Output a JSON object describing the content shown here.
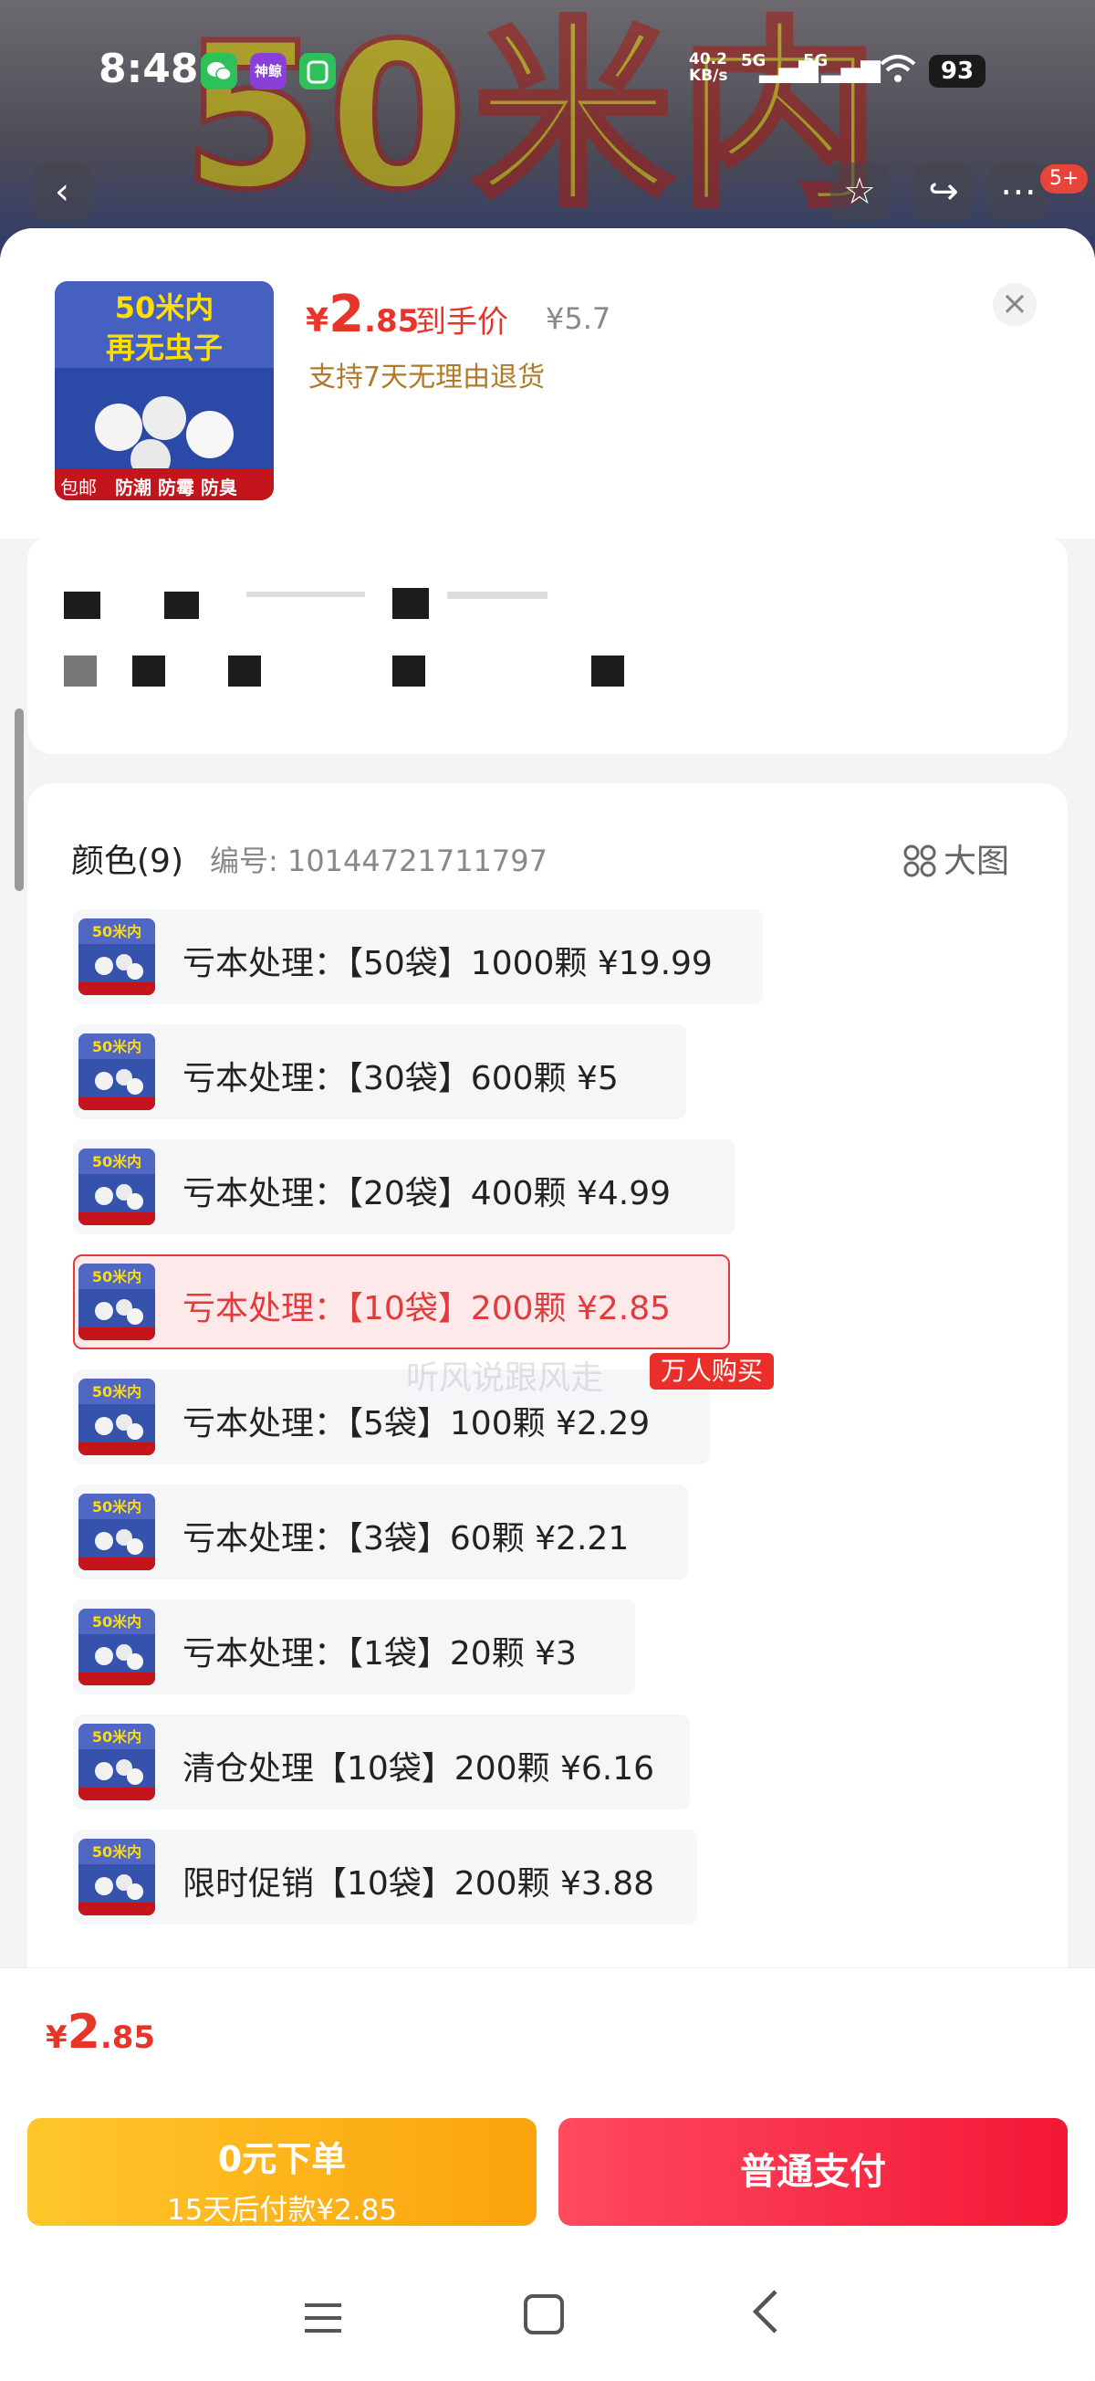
{
  "status_bar": {
    "time": "8:48",
    "network_speed_line1": "40.2",
    "network_speed_line2": "KB/s",
    "network_type_1": "5G",
    "network_type_2": "5G",
    "battery": "93",
    "apps": [
      {
        "name": "wechat-icon",
        "color": "#2ec15b"
      },
      {
        "name": "shenjing-icon",
        "color": "#8a3fd8",
        "text": "神鲸"
      },
      {
        "name": "mijia-icon",
        "color": "#2ec15b"
      }
    ]
  },
  "background_page": {
    "banner_text": "50米内",
    "message_badge": "5+"
  },
  "product_header": {
    "price_currency": "¥",
    "price_integer": "2",
    "price_decimal": ".85",
    "price_label": "到手价",
    "original_price": "¥5.7",
    "return_policy": "支持7天无理由退货",
    "image_text_line1": "50米内",
    "image_text_line2": "再无虫子",
    "image_tag_left": "包邮",
    "image_tags": "防潮 防霉 防臭"
  },
  "variants_section": {
    "title": "颜色(9)",
    "code": "编号: 10144721711797",
    "big_picture_label": "大图",
    "hot_badge": "万人购买",
    "watermark": "听风说跟风走",
    "items": [
      {
        "label": "亏本处理：【50袋】1000颗  ¥19.99",
        "selected": false
      },
      {
        "label": "亏本处理：【30袋】600颗  ¥5",
        "selected": false
      },
      {
        "label": "亏本处理：【20袋】400颗  ¥4.99",
        "selected": false
      },
      {
        "label": "亏本处理：【10袋】200颗  ¥2.85",
        "selected": true
      },
      {
        "label": "亏本处理：【5袋】100颗  ¥2.29",
        "selected": false
      },
      {
        "label": "亏本处理：【3袋】60颗  ¥2.21",
        "selected": false
      },
      {
        "label": "亏本处理：【1袋】20颗  ¥3",
        "selected": false
      },
      {
        "label": "清仓处理【10袋】200颗  ¥6.16",
        "selected": false
      },
      {
        "label": "限时促销【10袋】200颗  ¥3.88",
        "selected": false
      }
    ]
  },
  "bottom": {
    "price_currency": "¥",
    "price_integer": "2",
    "price_decimal": ".85",
    "credit_button_line1": "0元下单",
    "credit_button_line2": "15天后付款¥2.85",
    "pay_button": "普通支付"
  },
  "colors": {
    "accent_red": "#e8352a",
    "selected_border": "#e23b3b",
    "credit_yellow": "#fba30c",
    "pay_red": "#f31736"
  }
}
